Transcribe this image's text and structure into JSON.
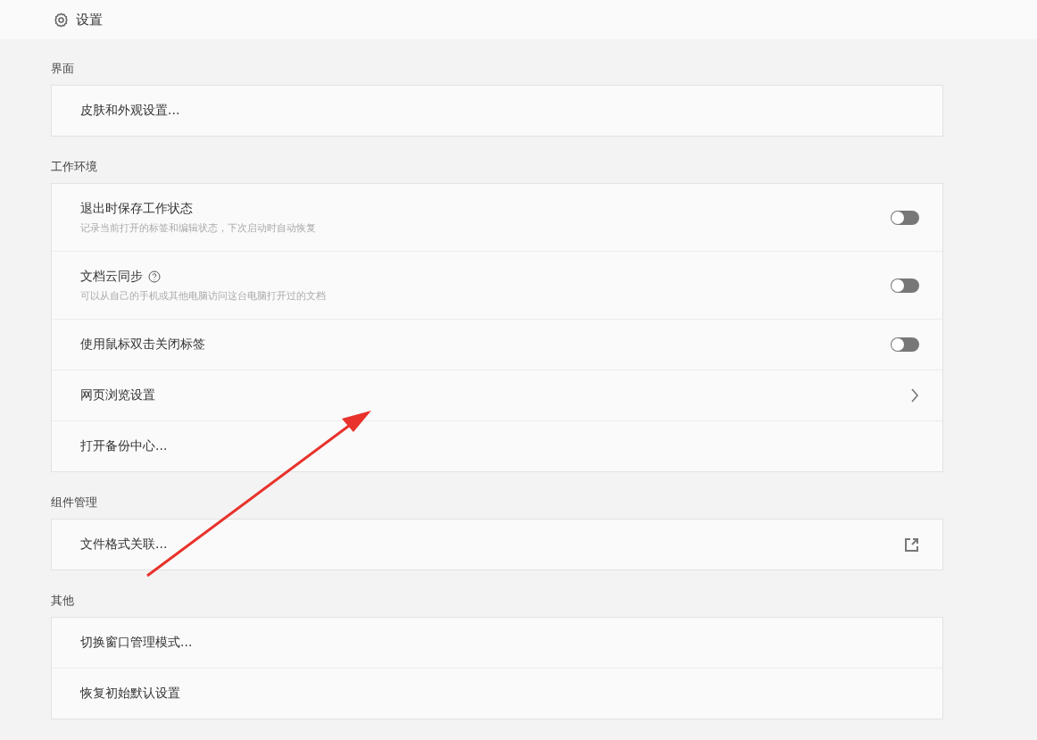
{
  "header": {
    "title": "设置"
  },
  "sections": [
    {
      "title": "界面",
      "items": [
        {
          "kind": "plain",
          "label": "皮肤和外观设置..."
        }
      ]
    },
    {
      "title": "工作环境",
      "items": [
        {
          "kind": "toggle",
          "label": "退出时保存工作状态",
          "description": "记录当前打开的标签和编辑状态，下次启动时自动恢复",
          "on": false
        },
        {
          "kind": "toggle",
          "label": "文档云同步",
          "help": true,
          "description": "可以从自己的手机或其他电脑访问这台电脑打开过的文档",
          "on": false
        },
        {
          "kind": "toggle",
          "label": "使用鼠标双击关闭标签",
          "on": false
        },
        {
          "kind": "chevron",
          "label": "网页浏览设置"
        },
        {
          "kind": "plain",
          "label": "打开备份中心..."
        }
      ]
    },
    {
      "title": "组件管理",
      "items": [
        {
          "kind": "external",
          "label": "文件格式关联..."
        }
      ]
    },
    {
      "title": "其他",
      "items": [
        {
          "kind": "plain",
          "label": "切换窗口管理模式..."
        },
        {
          "kind": "plain",
          "label": "恢复初始默认设置"
        }
      ]
    }
  ],
  "annotation": {
    "kind": "arrow"
  }
}
